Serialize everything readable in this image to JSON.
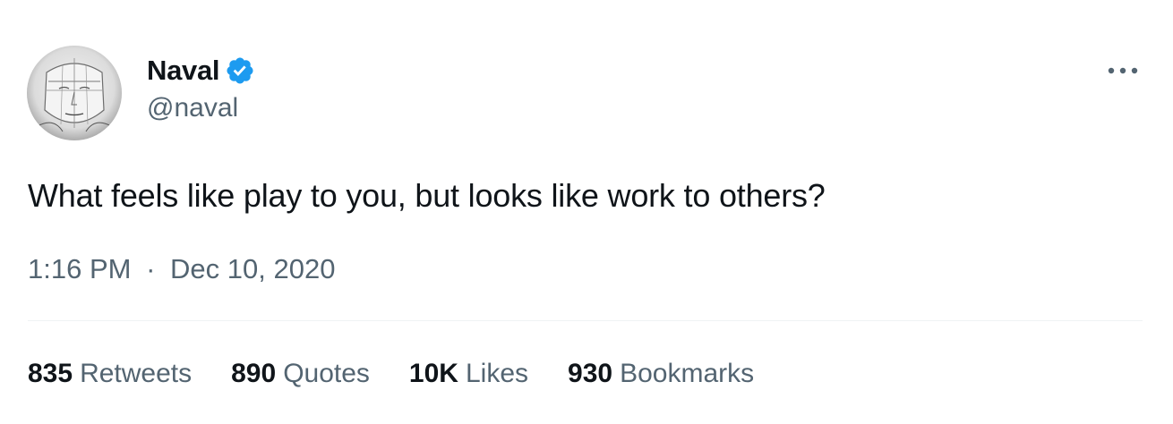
{
  "author": {
    "display_name": "Naval",
    "handle": "@naval",
    "verified": true,
    "verified_color": "#1d9bf0",
    "avatar_icon": "sketched-face-avatar"
  },
  "more_icon": "ellipsis-icon",
  "tweet": {
    "text": "What feels like play to you, but looks like work to others?",
    "time": "1:16 PM",
    "separator": "·",
    "date": "Dec 10, 2020"
  },
  "stats": [
    {
      "count": "835",
      "label": "Retweets"
    },
    {
      "count": "890",
      "label": "Quotes"
    },
    {
      "count": "10K",
      "label": "Likes"
    },
    {
      "count": "930",
      "label": "Bookmarks"
    }
  ],
  "colors": {
    "text_primary": "#0f1419",
    "text_secondary": "#536471",
    "divider": "#eff3f4"
  }
}
